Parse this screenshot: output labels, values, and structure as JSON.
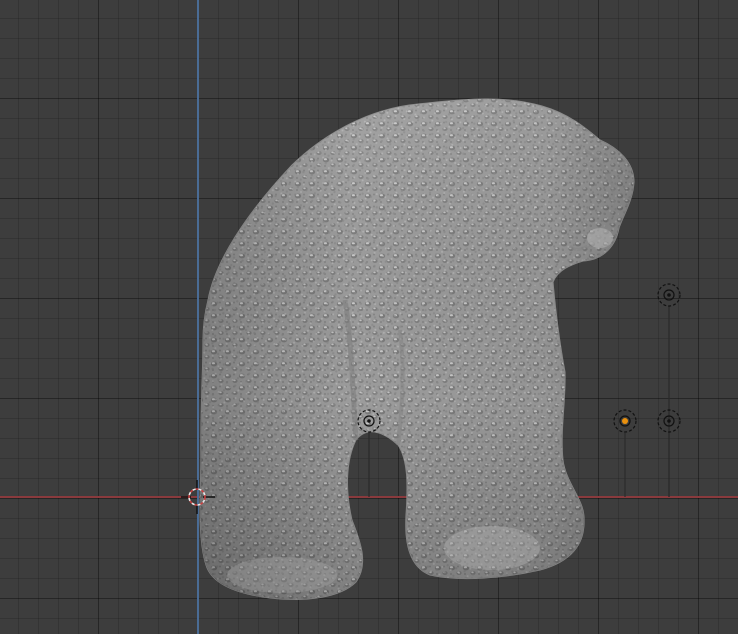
{
  "viewport": {
    "background_color": "#3d3d3d",
    "grid_major_color": "#333333",
    "grid_minor_color": "#383838",
    "x_axis_color": "#8a3a3d",
    "y_axis_color": "#4a6c95"
  },
  "object": {
    "icon": "sculpted-bear-mesh",
    "material_color": "#9e9e9e"
  },
  "origin": {
    "icon": "3d-cursor",
    "color": "#d9d9d9"
  },
  "light_markers": [
    {
      "icon": "light-empty",
      "state": "unselected"
    },
    {
      "icon": "light-empty",
      "state": "selected",
      "accent": "#e8900e"
    },
    {
      "icon": "light-empty",
      "state": "unselected"
    },
    {
      "icon": "light-empty",
      "state": "unselected"
    }
  ]
}
